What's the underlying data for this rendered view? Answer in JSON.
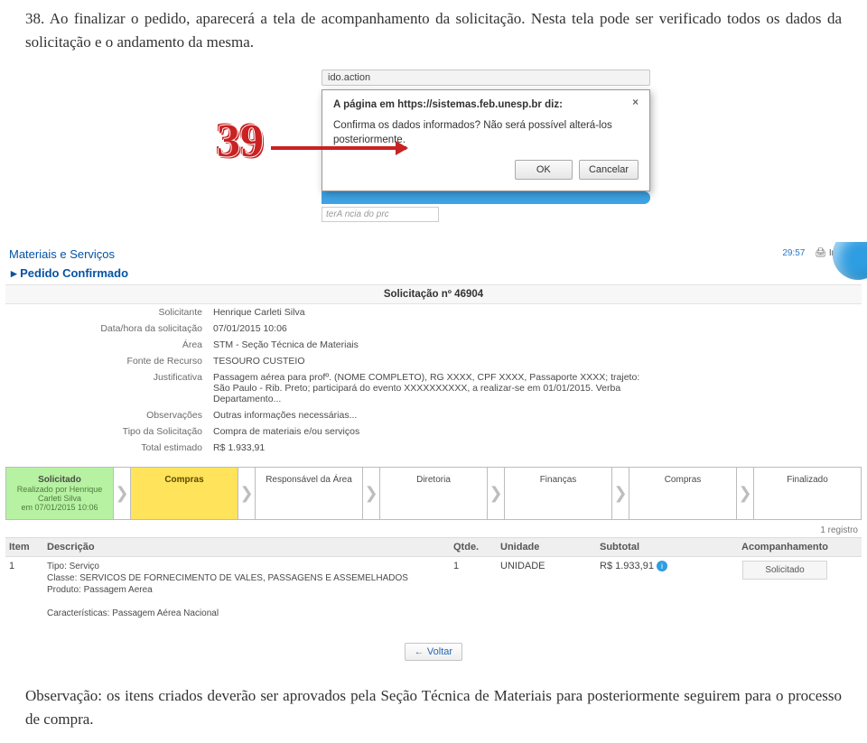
{
  "doc": {
    "step_number": "39",
    "intro": "38. Ao finalizar o pedido, aparecerá a tela de acompanhamento da solicitação. Nesta tela pode ser verificado todos os dados da solicitação e o andamento da mesma.",
    "obs": "Observação: os itens criados deverão ser aprovados pela Seção Técnica de Materiais para posteriormente seguirem para o processo de compra."
  },
  "dialog": {
    "url_fragment": "ido.action",
    "title": "A página em https://sistemas.feb.unesp.br diz:",
    "message": "Confirma os dados informados? Não será possível alterá-los posteriormente.",
    "ok": "OK",
    "cancel": "Cancelar",
    "below_input": "terA ncia do prc"
  },
  "sys": {
    "section": "Materiais e Serviços",
    "subsection": "Pedido Confirmado",
    "timer": "29:57",
    "print": "Imprimir",
    "req_title": "Solicitação nº 46904",
    "fields": {
      "solicitante_k": "Solicitante",
      "solicitante_v": "Henrique Carleti Silva",
      "datahora_k": "Data/hora da solicitação",
      "datahora_v": "07/01/2015 10:06",
      "area_k": "Área",
      "area_v": "STM - Seção Técnica de Materiais",
      "fonte_k": "Fonte de Recurso",
      "fonte_v": "TESOURO CUSTEIO",
      "just_k": "Justificativa",
      "just_v": "Passagem aérea para profº. (NOME COMPLETO), RG XXXX, CPF XXXX, Passaporte XXXX; trajeto: São Paulo - Rib. Preto; participará do evento XXXXXXXXXX, a realizar-se em 01/01/2015. Verba Departamento...",
      "obs_k": "Observações",
      "obs_v": "Outras informações necessárias...",
      "tipo_k": "Tipo da Solicitação",
      "tipo_v": "Compra de materiais e/ou serviços",
      "total_k": "Total estimado",
      "total_v": "R$ 1.933,91"
    },
    "wf": {
      "s1_title": "Solicitado",
      "s1_sub1": "Realizado por Henrique Carleti Silva",
      "s1_sub2": "em 07/01/2015 10:06",
      "s2": "Compras",
      "s3": "Responsável da Área",
      "s4": "Diretoria",
      "s5": "Finanças",
      "s6": "Compras",
      "s7": "Finalizado"
    },
    "table": {
      "registros": "1 registro",
      "h_item": "Item",
      "h_desc": "Descrição",
      "h_qtde": "Qtde.",
      "h_un": "Unidade",
      "h_sub": "Subtotal",
      "h_ac": "Acompanhamento",
      "r_item": "1",
      "r_tipo": "Tipo: Serviço",
      "r_classe": "Classe: SERVICOS DE FORNECIMENTO DE VALES, PASSAGENS E ASSEMELHADOS",
      "r_prod": "Produto: Passagem Aerea",
      "r_bold": "Passagem Aérea Nacional",
      "r_car": "Características: Passagem Aérea Nacional",
      "r_qt": "1",
      "r_un": "UNIDADE",
      "r_sub": "R$ 1.933,91",
      "r_ac": "Solicitado"
    },
    "voltar": "Voltar"
  }
}
